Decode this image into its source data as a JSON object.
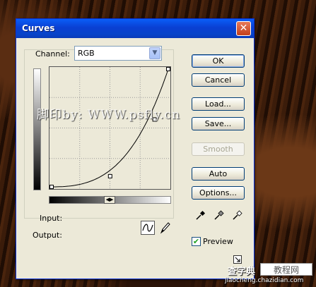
{
  "dialog": {
    "title": "Curves",
    "close_symbol": "✕"
  },
  "channel": {
    "label": "Channel:",
    "selected": "RGB",
    "dropdown_symbol": "▼"
  },
  "curve": {
    "points": [
      [
        0,
        0
      ],
      [
        128,
        23
      ],
      [
        255,
        255
      ]
    ],
    "node_points": [
      [
        0,
        0
      ],
      [
        128,
        23
      ],
      [
        225,
        146
      ],
      [
        255,
        255
      ]
    ]
  },
  "labels": {
    "input": "Input:",
    "output": "Output:",
    "gradient_toggle": "◀▶"
  },
  "buttons": {
    "ok": "OK",
    "cancel": "Cancel",
    "load": "Load...",
    "save": "Save...",
    "smooth": "Smooth",
    "auto": "Auto",
    "options": "Options..."
  },
  "preview": {
    "label": "Preview",
    "checked": true,
    "check_symbol": "✔"
  },
  "icons": [
    "curve-tool-icon",
    "pencil-icon",
    "black-eyedropper-icon",
    "gray-eyedropper-icon",
    "white-eyedropper-icon",
    "expand-icon"
  ],
  "watermarks": {
    "left": "脚印by: WWW.psfly.cn",
    "bottom_text": "查字典",
    "bottom_box": "教程网",
    "bottom_url": "jiaocheng.chazidian.com"
  }
}
